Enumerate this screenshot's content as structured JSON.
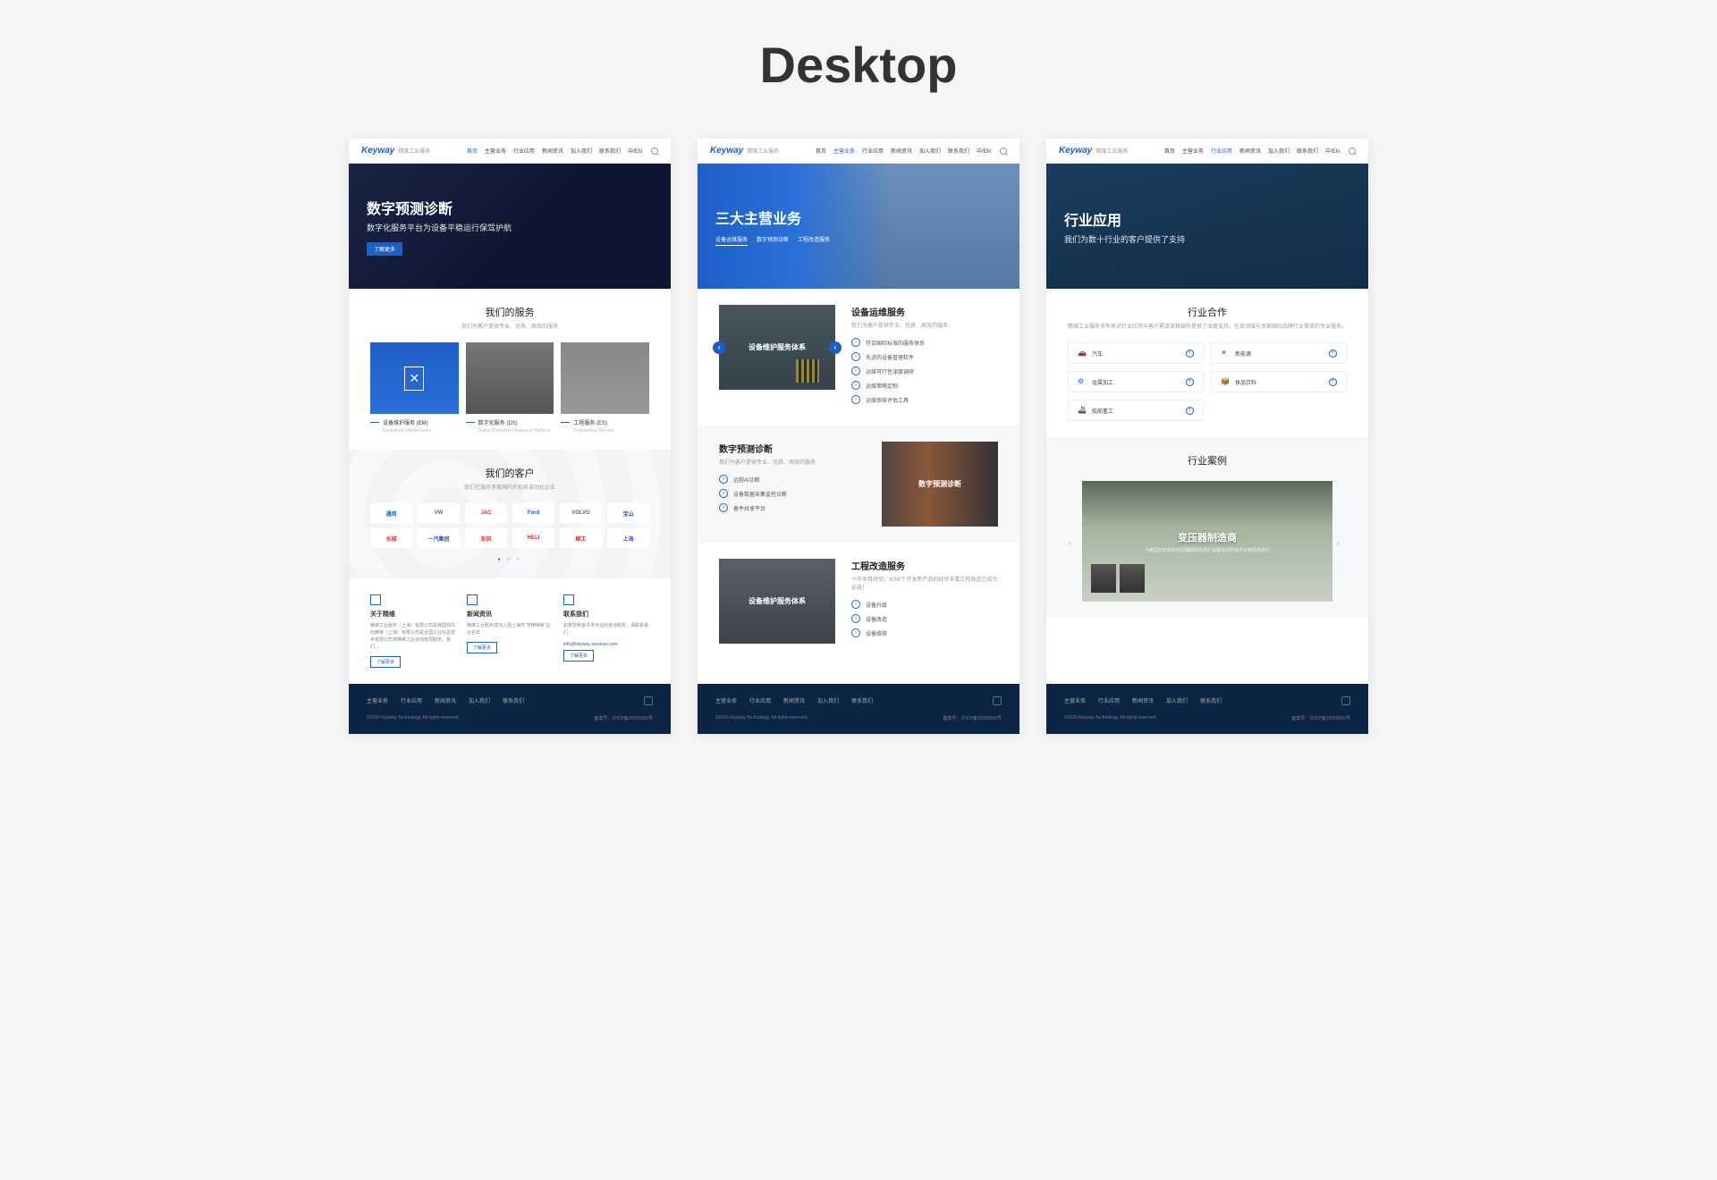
{
  "page_title": "Desktop",
  "brand": "Keyway",
  "brand_sub": "精维工业服务",
  "nav": [
    "首页",
    "主营业务",
    "行业应用",
    "新闻资讯",
    "加入我们",
    "联系我们"
  ],
  "nav_extra": "中/EN",
  "page1": {
    "nav_active_index": 0,
    "hero_title": "数字预测诊断",
    "hero_sub": "数字化服务平台为设备平稳运行保驾护航",
    "hero_btn": "了解更多",
    "services_title": "我们的服务",
    "services_sub": "我们为客户提供专业、优质、高效的服务",
    "services": [
      {
        "title": "设备维护服务 (EM)",
        "sub": "Equipment Maintenance"
      },
      {
        "title": "数字化服务 (DS)",
        "sub": "Digital Predictive Diagnosis Platform"
      },
      {
        "title": "工程服务 (ES)",
        "sub": "Engineering Service"
      }
    ],
    "customers_title": "我们的客户",
    "customers_sub": "我们已服务多家国内外知名自动化企业",
    "customers": [
      "通用",
      "VW",
      "JAC",
      "Ford",
      "VOLVO",
      "宝山",
      "长城",
      "一汽集团",
      "东风",
      "HELI",
      "柳工",
      "上海"
    ],
    "info_cols": [
      {
        "title": "关于精维",
        "text": "精维工业服务（上海）有限公司是我国领先的精维（上海）有限公司是全国工业信息技术有限公司将精维工业咨询有限服务，我们…",
        "btn": "了解更多"
      },
      {
        "title": "新闻资讯",
        "text": "精维工业服务成功入围上海市\"专精特新\"企业名单",
        "btn": "了解更多"
      },
      {
        "title": "联系我们",
        "text": "如果您希望寻求专业的咨询服务，请联系我们",
        "link": "info@keyway-services.com",
        "btn": "了解更多"
      }
    ]
  },
  "page2": {
    "nav_active_index": 1,
    "hero_title": "三大主营业务",
    "hero_tabs": [
      "设备运维服务",
      "数字预测诊断",
      "工程改造服务"
    ],
    "row1": {
      "img_label": "设备维护服务体系",
      "title": "设备运维服务",
      "sub": "我们为客户提供专业、优质、高效的服务",
      "items": [
        "符合国际标准的服务体系",
        "先进的设备管理软件",
        "运维可行性深度调研",
        "运维策略定制",
        "运维审核评估工具"
      ]
    },
    "row2": {
      "img_label": "数字预测诊断",
      "title": "数字预测诊断",
      "sub": "我们为客户提供专业、优质、高效的服务",
      "items": [
        "远程AI诊断",
        "设备数据采集监控诊断",
        "备件共享平台"
      ]
    },
    "row3": {
      "img_label": "设备维护服务体系",
      "title": "工程改造服务",
      "sub": "十年项目经验，3000个开发新产品的经验丰富工程改造已成为必选！",
      "items": [
        "设备升级",
        "设备改造",
        "设备维修"
      ]
    }
  },
  "page3": {
    "nav_active_index": 2,
    "hero_title": "行业应用",
    "hero_sub": "我们为数十行业的客户提供了支持",
    "coop_title": "行业合作",
    "coop_sub": "精维工业服务多年来对行业应用与客户需求深耕细作提供了深度支持。在各领域与多家国际品牌行业需求的专业服务。",
    "industries": [
      {
        "icon": "🚗",
        "label": "汽车"
      },
      {
        "icon": "☀",
        "label": "新能源"
      },
      {
        "icon": "⚙",
        "label": "金属加工"
      },
      {
        "icon": "📦",
        "label": "食品饮料"
      },
      {
        "icon": "🚢",
        "label": "船舶重工"
      }
    ],
    "case_title": "行业案例",
    "case_name": "变压器制造商",
    "case_desc": "为某国际知名的变压器制造商进行设备改造升级优化制造商进行"
  },
  "footer": {
    "links": [
      "主营业务",
      "行业应用",
      "新闻资讯",
      "加入我们",
      "联系我们"
    ],
    "copy": "©2020 Keyway Technology. All rights reserved.",
    "icp": "备案号：沪ICP备20000000号"
  }
}
